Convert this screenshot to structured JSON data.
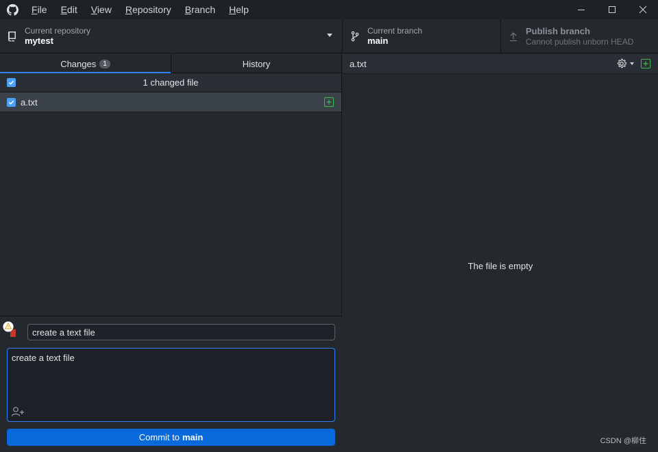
{
  "app": {
    "name": "GitHub Desktop"
  },
  "menu": [
    {
      "label": "File",
      "accel": "F",
      "rest": "ile"
    },
    {
      "label": "Edit",
      "accel": "E",
      "rest": "dit"
    },
    {
      "label": "View",
      "accel": "V",
      "rest": "iew"
    },
    {
      "label": "Repository",
      "accel": "R",
      "rest": "epository"
    },
    {
      "label": "Branch",
      "accel": "B",
      "rest": "ranch"
    },
    {
      "label": "Help",
      "accel": "H",
      "rest": "elp"
    }
  ],
  "toolbar": {
    "repository": {
      "label": "Current repository",
      "value": "mytest"
    },
    "branch": {
      "label": "Current branch",
      "value": "main"
    },
    "publish": {
      "label": "Publish branch",
      "description": "Cannot publish unborn HEAD"
    }
  },
  "tabs": [
    {
      "label": "Changes",
      "badge": "1",
      "selected": true
    },
    {
      "label": "History",
      "selected": false
    }
  ],
  "changes": {
    "header": "1 changed file",
    "files": [
      {
        "name": "a.txt",
        "status": "added",
        "checked": true
      }
    ]
  },
  "commit": {
    "summary": "create a text file",
    "description": "create a text file",
    "button_prefix": "Commit to",
    "button_branch": "main"
  },
  "diff": {
    "filename": "a.txt",
    "message": "The file is empty"
  },
  "watermark": "CSDN @柳住",
  "icons": {
    "logo": "github-logo-icon",
    "repo": "repo-icon",
    "branch": "git-branch-icon",
    "publish": "upload-icon",
    "gear": "gear-icon",
    "added": "diff-added-icon",
    "coauthor": "person-add-icon",
    "warning": "warning-icon"
  },
  "colors": {
    "accent": "#0969da",
    "selected_tab": "#2f81f7",
    "added": "#3fb950",
    "warning": "#e3b341"
  }
}
